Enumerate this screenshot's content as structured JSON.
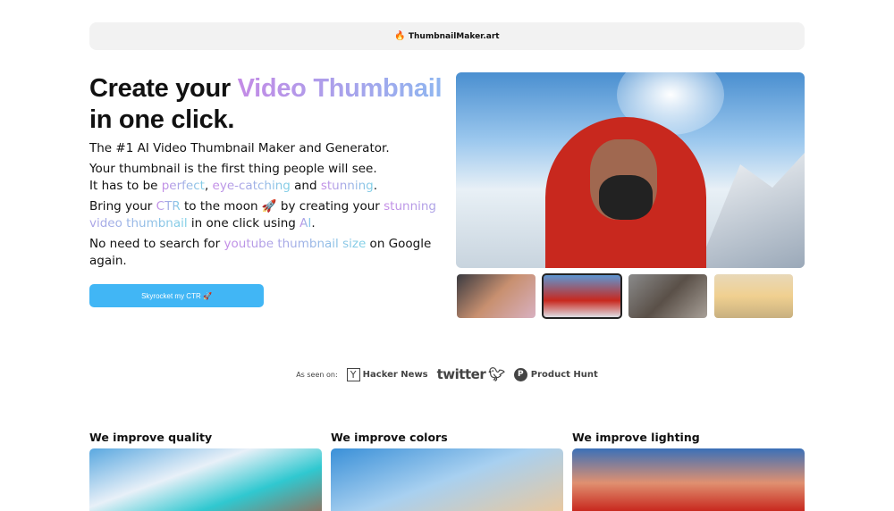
{
  "topbar": {
    "icon": "flame-icon",
    "brand": "ThumbnailMaker.art"
  },
  "hero": {
    "title_a": "Create your ",
    "title_b": "Video Thumbnail",
    "title_c": " in one click.",
    "line1": "The #1 AI Video Thumbnail Maker and Generator.",
    "line2": "Your thumbnail is the first thing people will see.",
    "line3a": "It has to be ",
    "line3b": "perfect",
    ", ": "",
    "line3c": "eye-catching",
    "line3d": " and ",
    "line3e": "stunning",
    "line3f": ".",
    "line4a": "Bring your ",
    "line4b": "CTR",
    "line4c": " to the moon 🚀 by creating your ",
    "line4d": "stunning video thumbnail",
    "line4e": " in one click using ",
    "line4f": "AI",
    "line4g": ".",
    "line5a": "No need to search for ",
    "line5b": "youtube thumbnail size",
    "line5c": " on Google again.",
    "cta": "Skyrocket my CTR 🚀"
  },
  "gallery": {
    "selected_index": 1,
    "thumb_count": 4
  },
  "seen": {
    "label": "As seen on:",
    "hn_icon": "Y",
    "hn": "Hacker News",
    "twitter": "twitter",
    "ph_icon": "P",
    "ph": "Product Hunt"
  },
  "features": [
    {
      "title": "We improve quality"
    },
    {
      "title": "We improve colors"
    },
    {
      "title": "We improve lighting"
    }
  ],
  "colors": {
    "accent": "#41b6f5",
    "gradient_start": "#c48be6",
    "gradient_end": "#7fd0e6"
  }
}
